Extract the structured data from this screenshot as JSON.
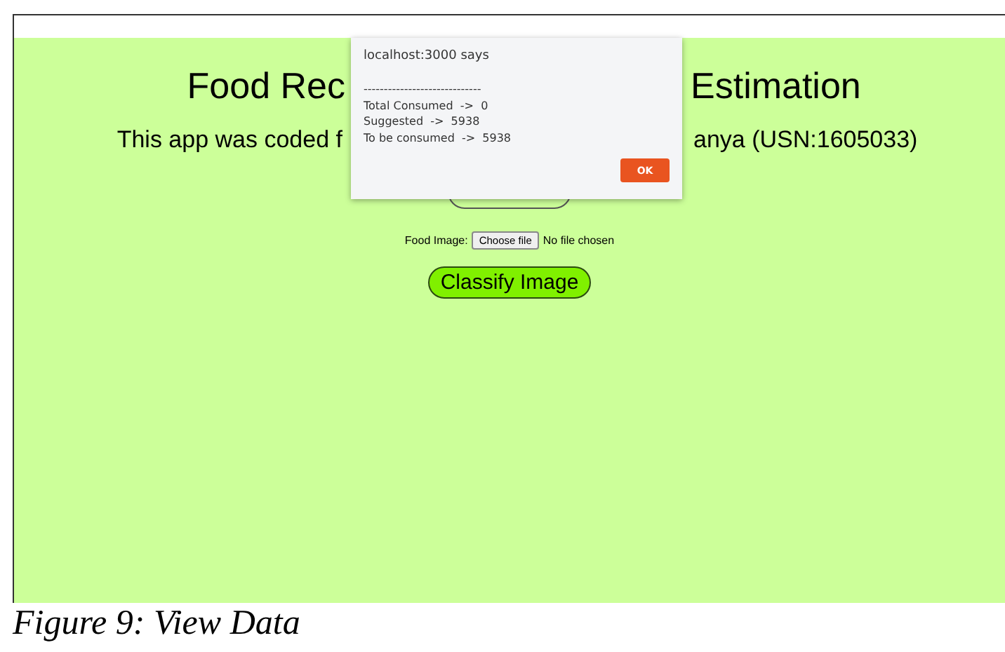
{
  "page": {
    "title_left": "Food Rec",
    "title_right": "Estimation",
    "subtitle_left": "This app was coded f",
    "subtitle_right": "anya (USN:1605033)",
    "file_input": {
      "label": "Food Image:",
      "button": "Choose file",
      "status": "No file chosen"
    },
    "classify_button": "Classify Image"
  },
  "dialog": {
    "origin": "localhost:3000 says",
    "separator": "-----------------------------",
    "lines": [
      "Total Consumed  ->  0",
      "Suggested  ->  5938",
      "To be consumed  ->  5938"
    ],
    "button": "OK"
  },
  "caption": "Figure 9: View Data"
}
